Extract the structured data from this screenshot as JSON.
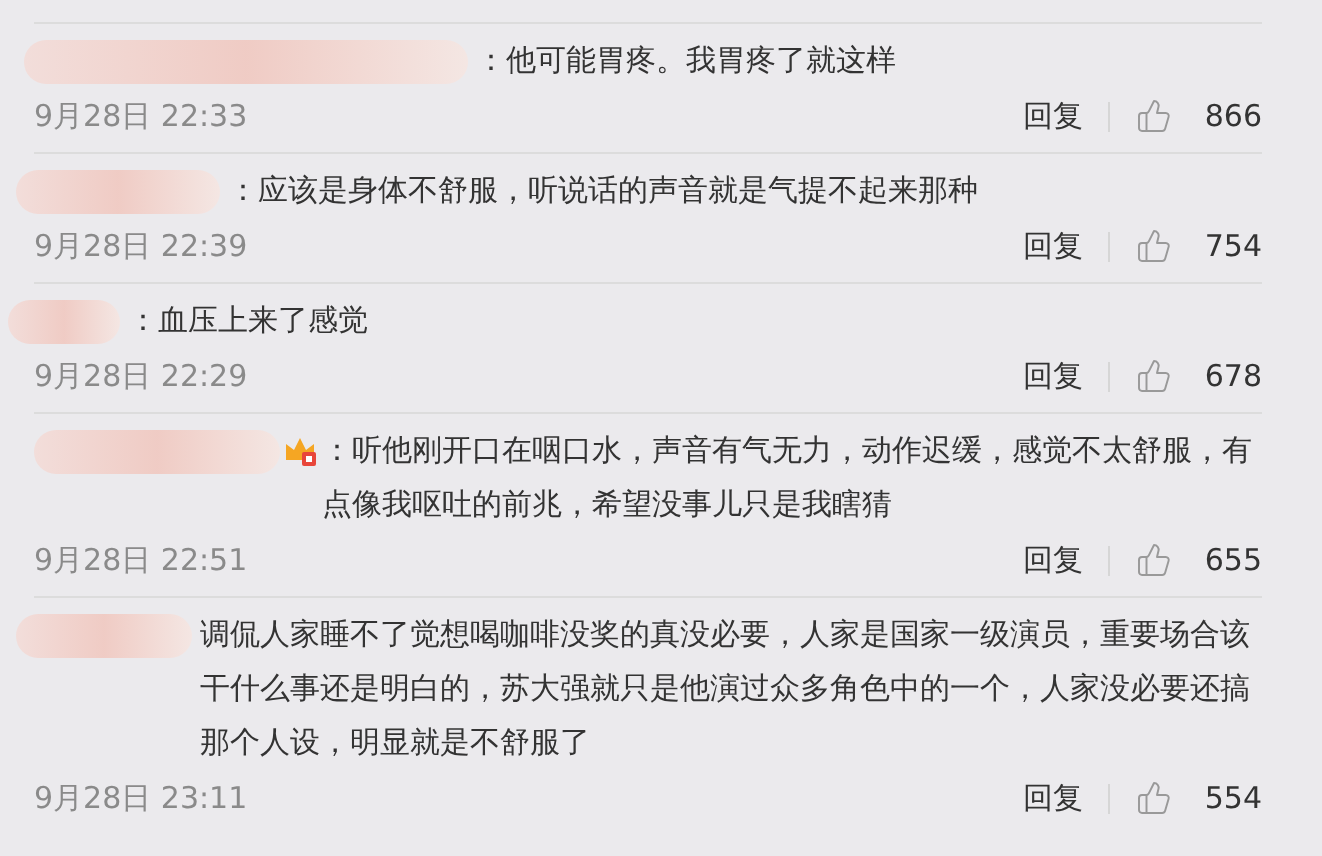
{
  "comments": [
    {
      "text": "：他可能胃疼。我胃疼了就这样",
      "badge": false,
      "time": "9月28日 22:33",
      "reply": "回复",
      "likes": "866"
    },
    {
      "text": "：应该是身体不舒服，听说话的声音就是气提不起来那种",
      "badge": false,
      "time": "9月28日 22:39",
      "reply": "回复",
      "likes": "754"
    },
    {
      "text": "：血压上来了感觉",
      "badge": false,
      "time": "9月28日 22:29",
      "reply": "回复",
      "likes": "678"
    },
    {
      "text": "：听他刚开口在咽口水，声音有气无力，动作迟缓，感觉不太舒服，有点像我呕吐的前兆，希望没事儿只是我瞎猜",
      "badge": true,
      "time": "9月28日 22:51",
      "reply": "回复",
      "likes": "655"
    },
    {
      "text": "调侃人家睡不了觉想喝咖啡没奖的真没必要，人家是国家一级演员，重要场合该干什么事还是明白的，苏大强就只是他演过众多角色中的一个，人家没必要还搞那个人设，明显就是不舒服了",
      "badge": false,
      "time": "9月28日 23:11",
      "reply": "回复",
      "likes": "554"
    }
  ]
}
